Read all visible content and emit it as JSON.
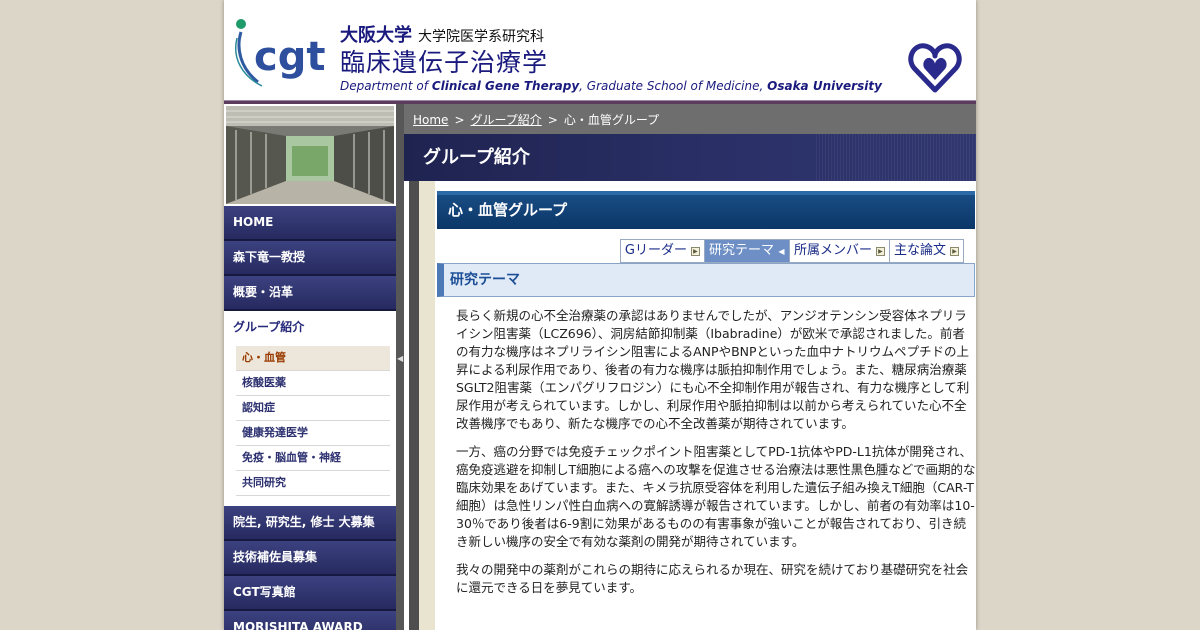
{
  "header": {
    "univ_name": "大阪大学",
    "school_name": "大学院医学系研究科",
    "dept_title": "臨床遺伝子治療学",
    "dept_en_prefix": "Department of ",
    "dept_en_dept": "Clinical Gene Therapy",
    "dept_en_mid": ", Graduate School of Medicine, ",
    "dept_en_univ": "Osaka University",
    "logo_text": "cgt"
  },
  "breadcrumb": {
    "home": "Home",
    "sep": ">",
    "groups": "グループ紹介",
    "current": "心・血管グループ"
  },
  "page_header": "グループ紹介",
  "sidebar": {
    "nav_top": [
      {
        "label": "HOME"
      },
      {
        "label": "森下竜一教授"
      },
      {
        "label": "概要・沿革"
      }
    ],
    "nav_active": "グループ紹介",
    "subnav": [
      {
        "label": "心・血管"
      },
      {
        "label": "核酸医薬"
      },
      {
        "label": "認知症"
      },
      {
        "label": "健康発達医学"
      },
      {
        "label": "免疫・脳血管・神経"
      },
      {
        "label": "共同研究"
      }
    ],
    "nav_bottom": [
      {
        "label": "院生, 研究生, 修士 大募集"
      },
      {
        "label": "技術補佐員募集"
      },
      {
        "label": "CGT写真館"
      },
      {
        "label": "MORISHITA AWARD"
      }
    ]
  },
  "group_title": "心・血管グループ",
  "tabs": [
    {
      "label": "Gリーダー"
    },
    {
      "label": "研究テーマ"
    },
    {
      "label": "所属メンバー"
    },
    {
      "label": "主な論文"
    }
  ],
  "section_title": "研究テーマ",
  "paragraphs": [
    "長らく新規の心不全治療薬の承認はありませんでしたが、アンジオテンシン受容体ネプリライシン阻害薬（LCZ696）、洞房結節抑制薬（Ibabradine）が欧米で承認されました。前者の有力な機序はネプリライシン阻害によるANPやBNPといった血中ナトリウムペプチドの上昇による利尿作用であり、後者の有力な機序は脈拍抑制作用でしょう。また、糖尿病治療薬SGLT2阻害薬（エンパグリフロジン）にも心不全抑制作用が報告され、有力な機序として利尿作用が考えられています。しかし、利尿作用や脈拍抑制は以前から考えられていた心不全改善機序でもあり、新たな機序での心不全改善薬が期待されています。",
    "一方、癌の分野では免疫チェックポイント阻害薬としてPD-1抗体やPD-L1抗体が開発され、癌免疫逃避を抑制しT細胞による癌への攻撃を促進させる治療法は悪性黒色腫などで画期的な臨床効果をあげています。また、キメラ抗原受容体を利用した遺伝子組み換えT細胞（CAR-T細胞）は急性リンパ性白血病への寛解誘導が報告されています。しかし、前者の有効率は10-30％であり後者は6-9割に効果があるものの有害事象が強いことが報告されており、引き続き新しい機序の安全で有効な薬剤の開発が期待されています。",
    "我々の開発中の薬剤がこれらの期待に応えられるか現在、研究を続けており基礎研究を社会に還元できる日を夢見ています。"
  ]
}
